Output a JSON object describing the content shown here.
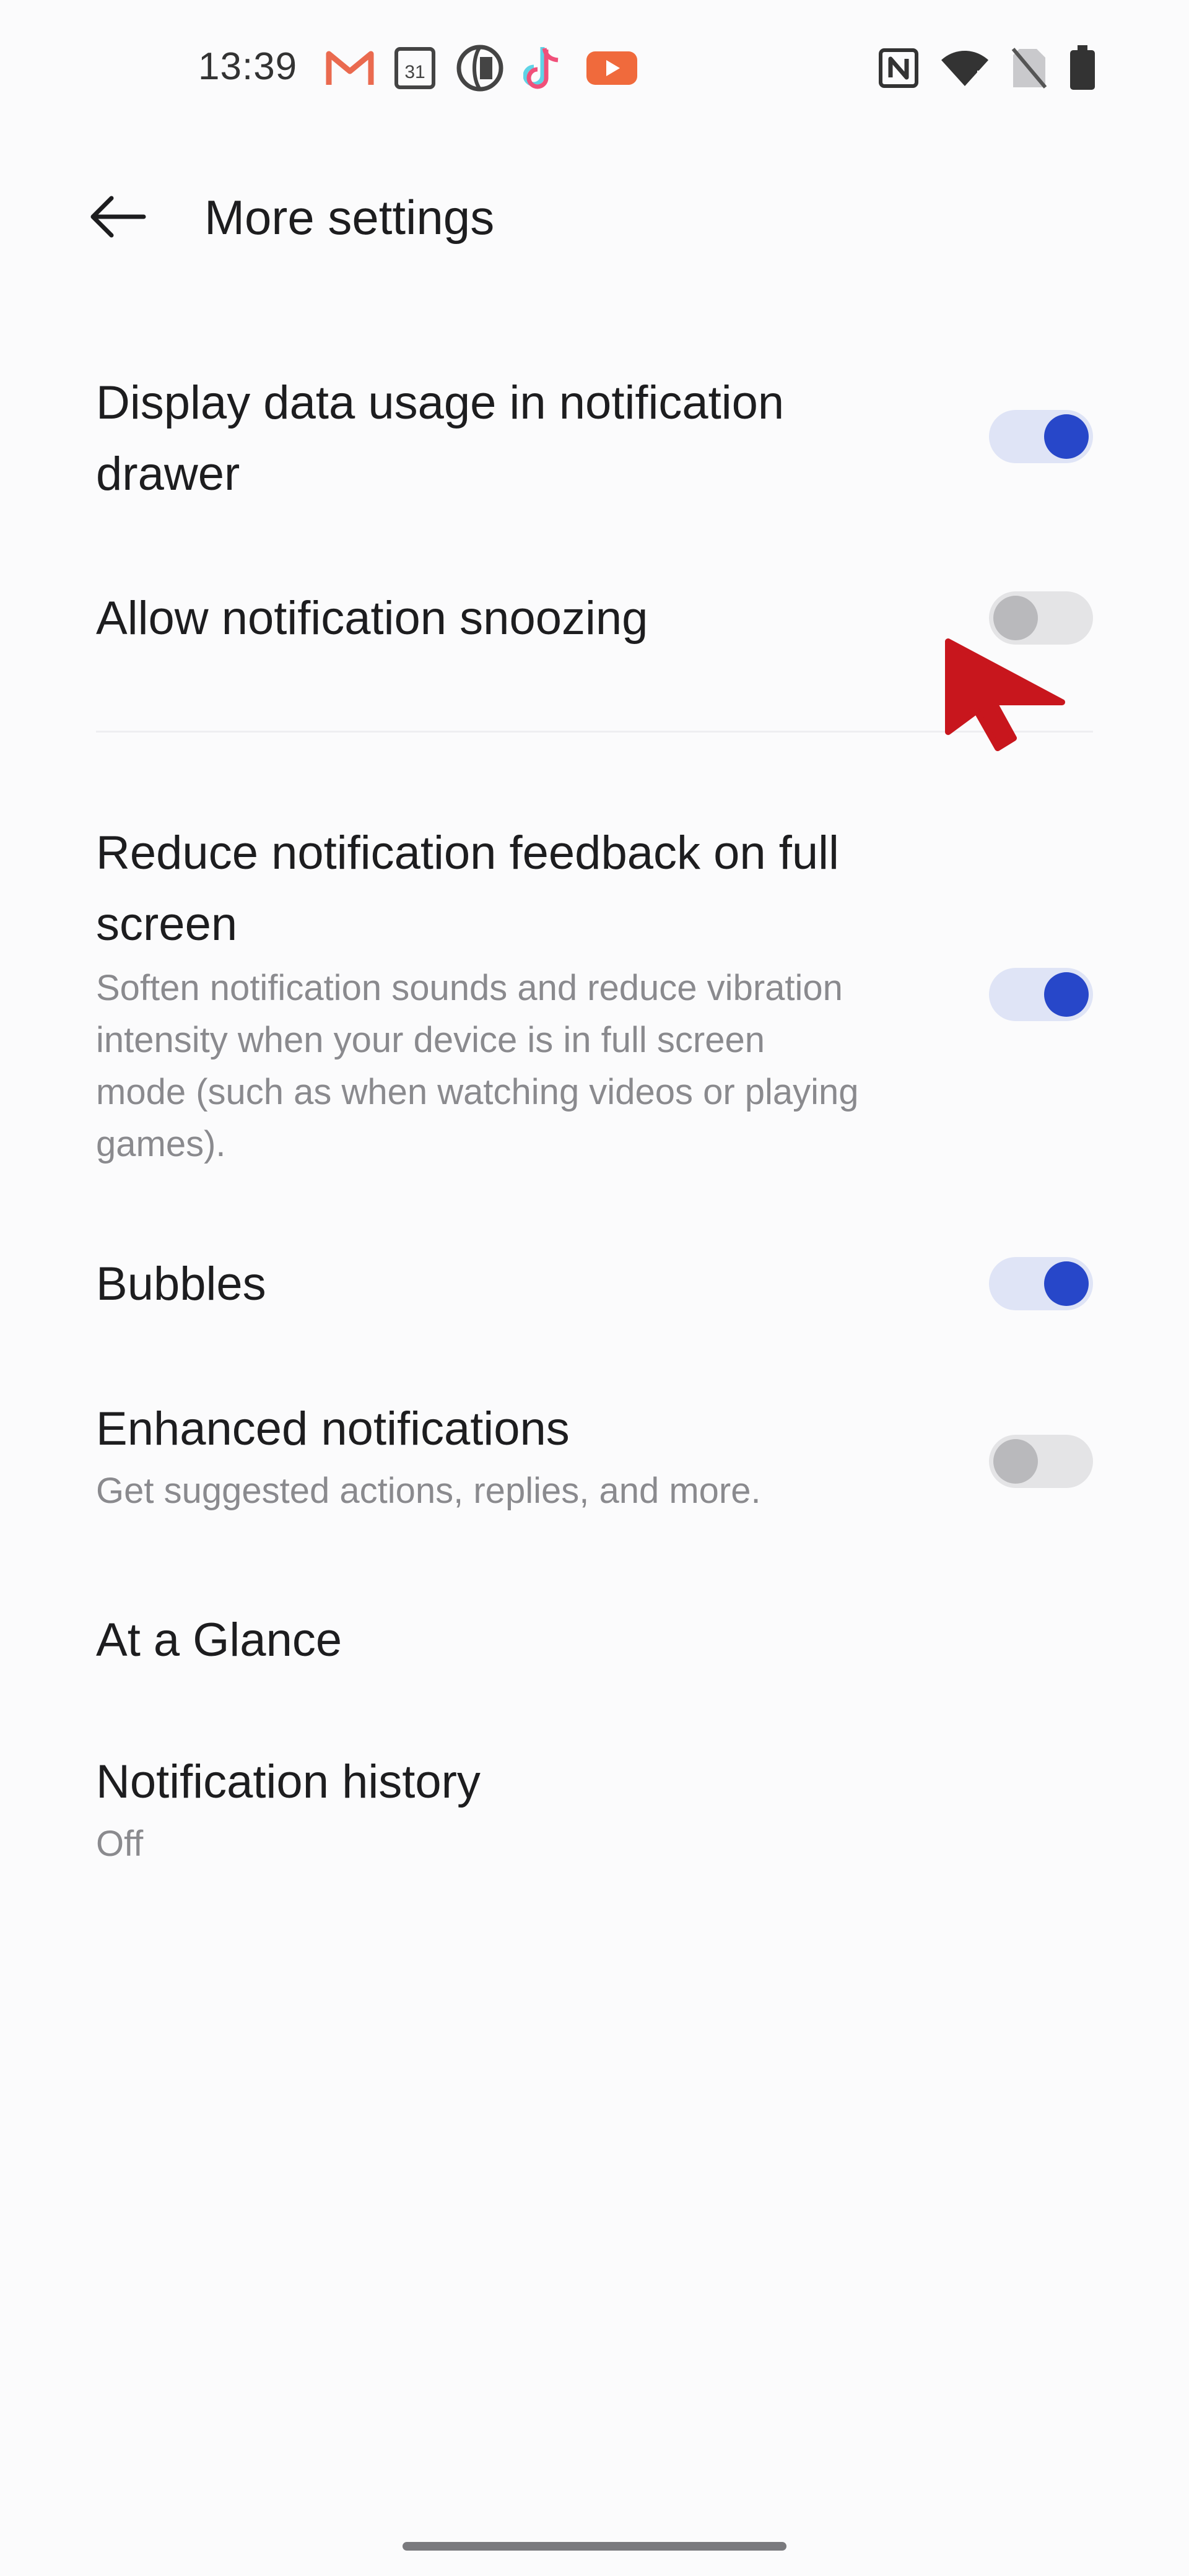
{
  "status_bar": {
    "time": "13:39",
    "app_icons": [
      "gmail-icon",
      "calendar-icon",
      "globe-app-icon",
      "tiktok-icon",
      "youtube-icon"
    ],
    "calendar_day": "31",
    "system_icons": [
      "nfc-icon",
      "wifi-icon",
      "sim-off-icon",
      "battery-icon"
    ]
  },
  "header": {
    "back_icon": "arrow-left-icon",
    "title": "More settings"
  },
  "settings": [
    {
      "title_lines": [
        "Display data usage in notification",
        "drawer"
      ],
      "toggle": true
    },
    {
      "title_lines": [
        "Allow notification snoozing"
      ],
      "toggle": false
    },
    {
      "title_lines": [
        "Reduce notification feedback on full",
        "screen"
      ],
      "description_lines": [
        "Soften notification sounds and reduce vibration",
        "intensity when your device is in full screen",
        "mode (such as when watching videos or playing",
        "games)."
      ],
      "toggle": true
    },
    {
      "title_lines": [
        "Bubbles"
      ],
      "toggle": true
    },
    {
      "title_lines": [
        "Enhanced notifications"
      ],
      "description_lines": [
        "Get suggested actions, replies, and more."
      ],
      "toggle": false
    },
    {
      "title_lines": [
        "At a Glance"
      ]
    },
    {
      "title_lines": [
        "Notification history"
      ],
      "description_lines": [
        "Off"
      ]
    }
  ],
  "colors": {
    "toggle_on_knob": "#2747c9",
    "toggle_on_track": "#dfe4f6",
    "toggle_off_knob": "#b9b9bc",
    "toggle_off_track": "#e4e4e6",
    "cursor": "#c8161d"
  }
}
